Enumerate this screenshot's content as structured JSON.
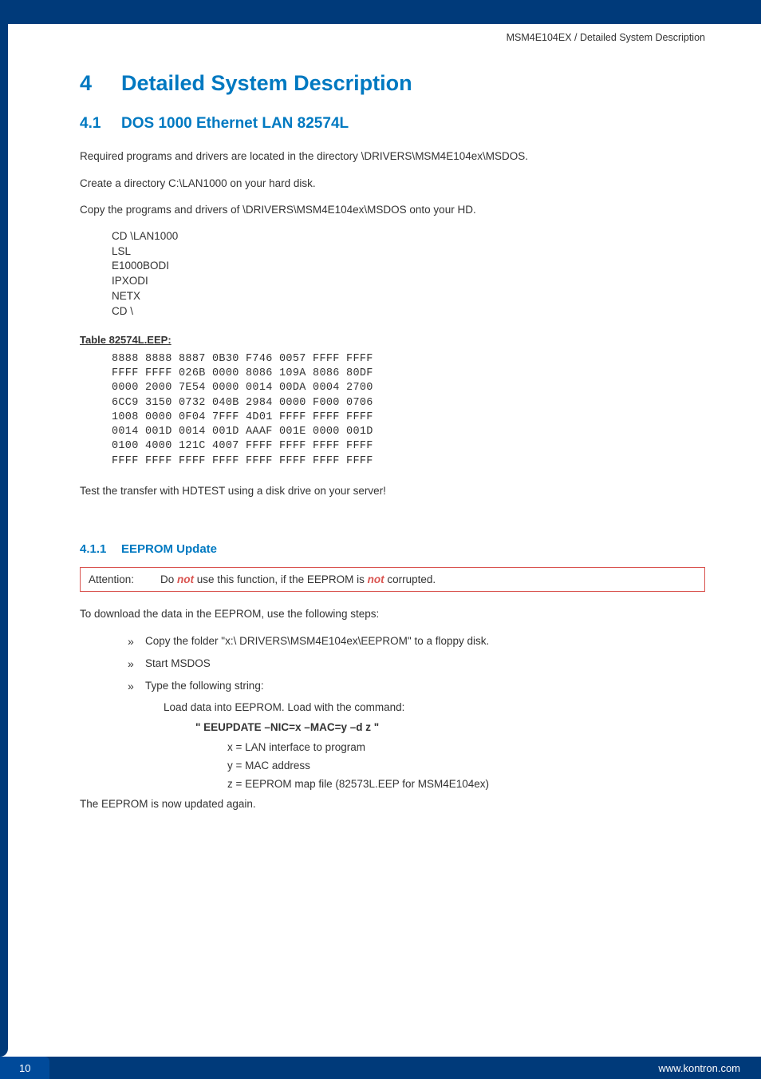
{
  "header": {
    "breadcrumb": "MSM4E104EX / Detailed System Description"
  },
  "h1": {
    "num": "4",
    "title": "Detailed System Description"
  },
  "h2": {
    "num": "4.1",
    "title": "DOS 1000 Ethernet LAN 82574L"
  },
  "intro": {
    "p1": "Required programs and drivers are located in the directory \\DRIVERS\\MSM4E104ex\\MSDOS.",
    "p2": "Create a directory C:\\LAN1000 on your hard disk.",
    "p3": "Copy the programs and drivers of \\DRIVERS\\MSM4E104ex\\MSDOS onto your HD."
  },
  "commands": [
    "CD \\LAN1000",
    "LSL",
    "E1000BODI",
    "IPXODI",
    "NETX",
    "CD \\"
  ],
  "table_label": "Table 82574L.EEP:",
  "hex": "8888 8888 8887 0B30 F746 0057 FFFF FFFF\nFFFF FFFF 026B 0000 8086 109A 8086 80DF\n0000 2000 7E54 0000 0014 00DA 0004 2700\n6CC9 3150 0732 040B 2984 0000 F000 0706\n1008 0000 0F04 7FFF 4D01 FFFF FFFF FFFF\n0014 001D 0014 001D AAAF 001E 0000 001D\n0100 4000 121C 4007 FFFF FFFF FFFF FFFF\nFFFF FFFF FFFF FFFF FFFF FFFF FFFF FFFF",
  "posthex": "Test the transfer with HDTEST using a disk drive on your server!",
  "h3": {
    "num": "4.1.1",
    "title": "EEPROM Update"
  },
  "attention": {
    "label": "Attention:",
    "pre": "Do ",
    "not1": "not",
    "mid": " use this function, if the EEPROM is ",
    "not2": "not",
    "post": " corrupted."
  },
  "eeprom_intro": "To download the data in the EEPROM, use the following steps:",
  "steps": {
    "s1": "Copy the folder \"x:\\ DRIVERS\\MSM4E104ex\\EEPROM\" to a floppy disk.",
    "s2": "Start MSDOS",
    "s3": "Type the following string:",
    "s3a": "Load data into EEPROM. Load with the command:",
    "s3b": "\" EEUPDATE –NIC=x –MAC=y –d z \"",
    "s3c": "x = LAN interface to program",
    "s3d": "y = MAC address",
    "s3e": "z = EEPROM map file (82573L.EEP for MSM4E104ex)"
  },
  "outro": "The EEPROM is now updated again.",
  "footer": {
    "page": "10",
    "url": "www.kontron.com"
  }
}
